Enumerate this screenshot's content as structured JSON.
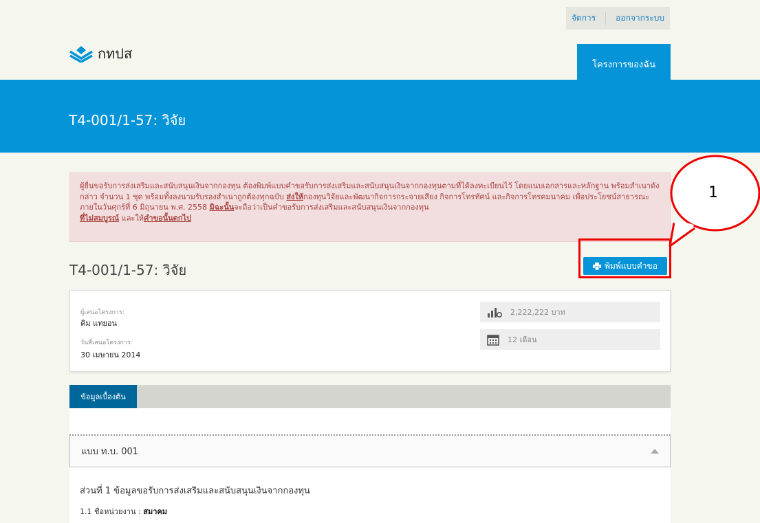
{
  "topbar": {
    "manage": "จัดการ",
    "logout": "ออกจากระบบ"
  },
  "logo": {
    "text": "กทปส",
    "icon": "stacked-chevron-logo-icon"
  },
  "nav": {
    "my_projects": "โครงการของฉัน"
  },
  "banner": {
    "title": "T4-001/1-57: วิจัย"
  },
  "alert": {
    "p1": "ผู้ยื่นขอรับการส่งเสริมและสนับสนุนเงินจากกองทุน ต้องพิมพ์แบบคำขอรับการส่งเสริมและสนับสนุนเงินจากกองทุนตามที่ได้ลงทะเบียนไว้ โดยแนบเอกสารและหลักฐาน พร้อมสำเนาดังกล่าว จำนวน 1 ชุด พร้อมทั้งลงนามรับรองสำเนาถูกต้องทุกฉบับ ",
    "link1": "ส่งให้",
    "p2": "กองทุนวิจัยและพัฒนากิจการกระจายเสียง กิจการโทรทัศน์ และกิจการโทรคมนาคม เพื่อประโยชน์สาธารณะ ภายในวันศุกร์ที่ 6 มิถุนายน พ.ศ. 2558 ",
    "link2": "มิฉะนั้น",
    "p3": "จะถือว่าเป็นคำขอรับการส่งเสริมและสนับสนุนเงินจากกองทุน",
    "link3": "ที่ไม่สมบูรณ์",
    "p4": " และให้",
    "link4": "คำขอนั้นตกไป"
  },
  "page": {
    "title": "T4-001/1-57: วิจัย"
  },
  "print_button": {
    "label": "พิมพ์แบบคำขอ",
    "icon": "printer-icon"
  },
  "annotation": {
    "number": "1",
    "color": "#ee0000"
  },
  "info": {
    "proposer_label": "ผู้เสนอโครงการ:",
    "proposer_value": "คิม แทยอน",
    "date_label": "วันที่เสนอโครงการ:",
    "date_value": "30 เมษายน 2014",
    "budget": "2,222,222 บาท",
    "duration": "12 เดือน"
  },
  "tabs": {
    "basic_info": "ข้อมูลเบื้องต้น"
  },
  "form": {
    "accordion_title": "แบบ ท.บ. 001",
    "section_title": "ส่วนที่ 1 ข้อมูลขอรับการส่งเสริมและสนับสนุนเงินจากกองทุน",
    "field_label": "1.1 ชื่อหน่วยงาน :",
    "field_value": "สมาคม"
  },
  "colors": {
    "primary": "#0594d8",
    "tab_active": "#00679a",
    "alert_bg": "#f2dede",
    "alert_text": "#a94442"
  }
}
